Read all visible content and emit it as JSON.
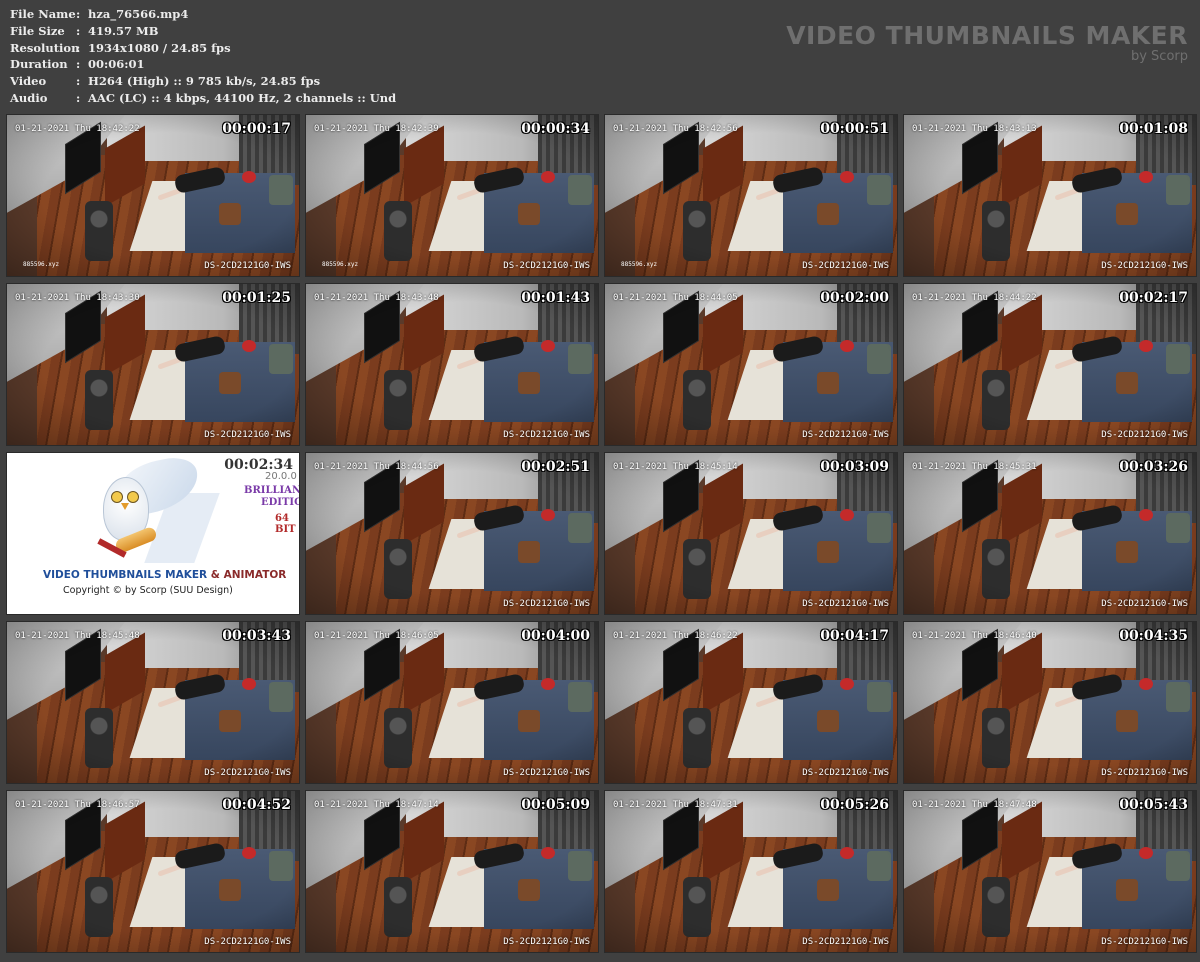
{
  "info": {
    "rows": [
      {
        "key": "File Name",
        "value": "hza_76566.mp4"
      },
      {
        "key": "File Size",
        "value": "419.57 MB"
      },
      {
        "key": "Resolution",
        "value": "1934x1080 / 24.85 fps"
      },
      {
        "key": "Duration",
        "value": "00:06:01"
      },
      {
        "key": "Video",
        "value": "H264 (High) :: 9 785 kb/s, 24.85 fps"
      },
      {
        "key": "Audio",
        "value": "AAC (LC) :: 4 kbps, 44100 Hz, 2 channels :: Und"
      }
    ],
    "separator": ":"
  },
  "brand": {
    "title": "VIDEO THUMBNAILS MAKER",
    "subtitle": "by Scorp"
  },
  "thumbnails": [
    {
      "time": "00:00:17",
      "date": "01-21-2021 Thu 18:42:22",
      "cam": "DS-2CD2121G0-IWS",
      "small": "885596.xyz"
    },
    {
      "time": "00:00:34",
      "date": "01-21-2021 Thu 18:42:39",
      "cam": "DS-2CD2121G0-IWS",
      "small": "885596.xyz"
    },
    {
      "time": "00:00:51",
      "date": "01-21-2021 Thu 18:42:56",
      "cam": "DS-2CD2121G0-IWS",
      "small": "885596.xyz"
    },
    {
      "time": "00:01:08",
      "date": "01-21-2021 Thu 18:43:13",
      "cam": "DS-2CD2121G0-IWS",
      "small": ""
    },
    {
      "time": "00:01:25",
      "date": "01-21-2021 Thu 18:43:30",
      "cam": "DS-2CD2121G0-IWS",
      "small": ""
    },
    {
      "time": "00:01:43",
      "date": "01-21-2021 Thu 18:43:48",
      "cam": "DS-2CD2121G0-IWS",
      "small": ""
    },
    {
      "time": "00:02:00",
      "date": "01-21-2021 Thu 18:44:05",
      "cam": "DS-2CD2121G0-IWS",
      "small": ""
    },
    {
      "time": "00:02:17",
      "date": "01-21-2021 Thu 18:44:22",
      "cam": "DS-2CD2121G0-IWS",
      "small": ""
    },
    {
      "time": "00:02:34",
      "logo": true
    },
    {
      "time": "00:02:51",
      "date": "01-21-2021 Thu 18:44:56",
      "cam": "DS-2CD2121G0-IWS",
      "small": ""
    },
    {
      "time": "00:03:09",
      "date": "01-21-2021 Thu 18:45:14",
      "cam": "DS-2CD2121G0-IWS",
      "small": ""
    },
    {
      "time": "00:03:26",
      "date": "01-21-2021 Thu 18:45:31",
      "cam": "DS-2CD2121G0-IWS",
      "small": ""
    },
    {
      "time": "00:03:43",
      "date": "01-21-2021 Thu 18:45:48",
      "cam": "DS-2CD2121G0-IWS",
      "small": ""
    },
    {
      "time": "00:04:00",
      "date": "01-21-2021 Thu 18:46:05",
      "cam": "DS-2CD2121G0-IWS",
      "small": ""
    },
    {
      "time": "00:04:17",
      "date": "01-21-2021 Thu 18:46:22",
      "cam": "DS-2CD2121G0-IWS",
      "small": ""
    },
    {
      "time": "00:04:35",
      "date": "01-21-2021 Thu 18:46:40",
      "cam": "DS-2CD2121G0-IWS",
      "small": ""
    },
    {
      "time": "00:04:52",
      "date": "01-21-2021 Thu 18:46:57",
      "cam": "DS-2CD2121G0-IWS",
      "small": ""
    },
    {
      "time": "00:05:09",
      "date": "01-21-2021 Thu 18:47:14",
      "cam": "DS-2CD2121G0-IWS",
      "small": ""
    },
    {
      "time": "00:05:26",
      "date": "01-21-2021 Thu 18:47:31",
      "cam": "DS-2CD2121G0-IWS",
      "small": ""
    },
    {
      "time": "00:05:43",
      "date": "01-21-2021 Thu 18:47:48",
      "cam": "DS-2CD2121G0-IWS",
      "small": ""
    }
  ],
  "logo_tile": {
    "version": "20.0.0",
    "edition_line1": "BRILLIANT",
    "edition_line2": "EDITION",
    "bits": "64 BIT",
    "name_part1": "VIDEO THUMBNAILS MAKER",
    "name_part2": " & ANIMATOR",
    "copyright": "Copyright © by Scorp (SUU Design)"
  }
}
